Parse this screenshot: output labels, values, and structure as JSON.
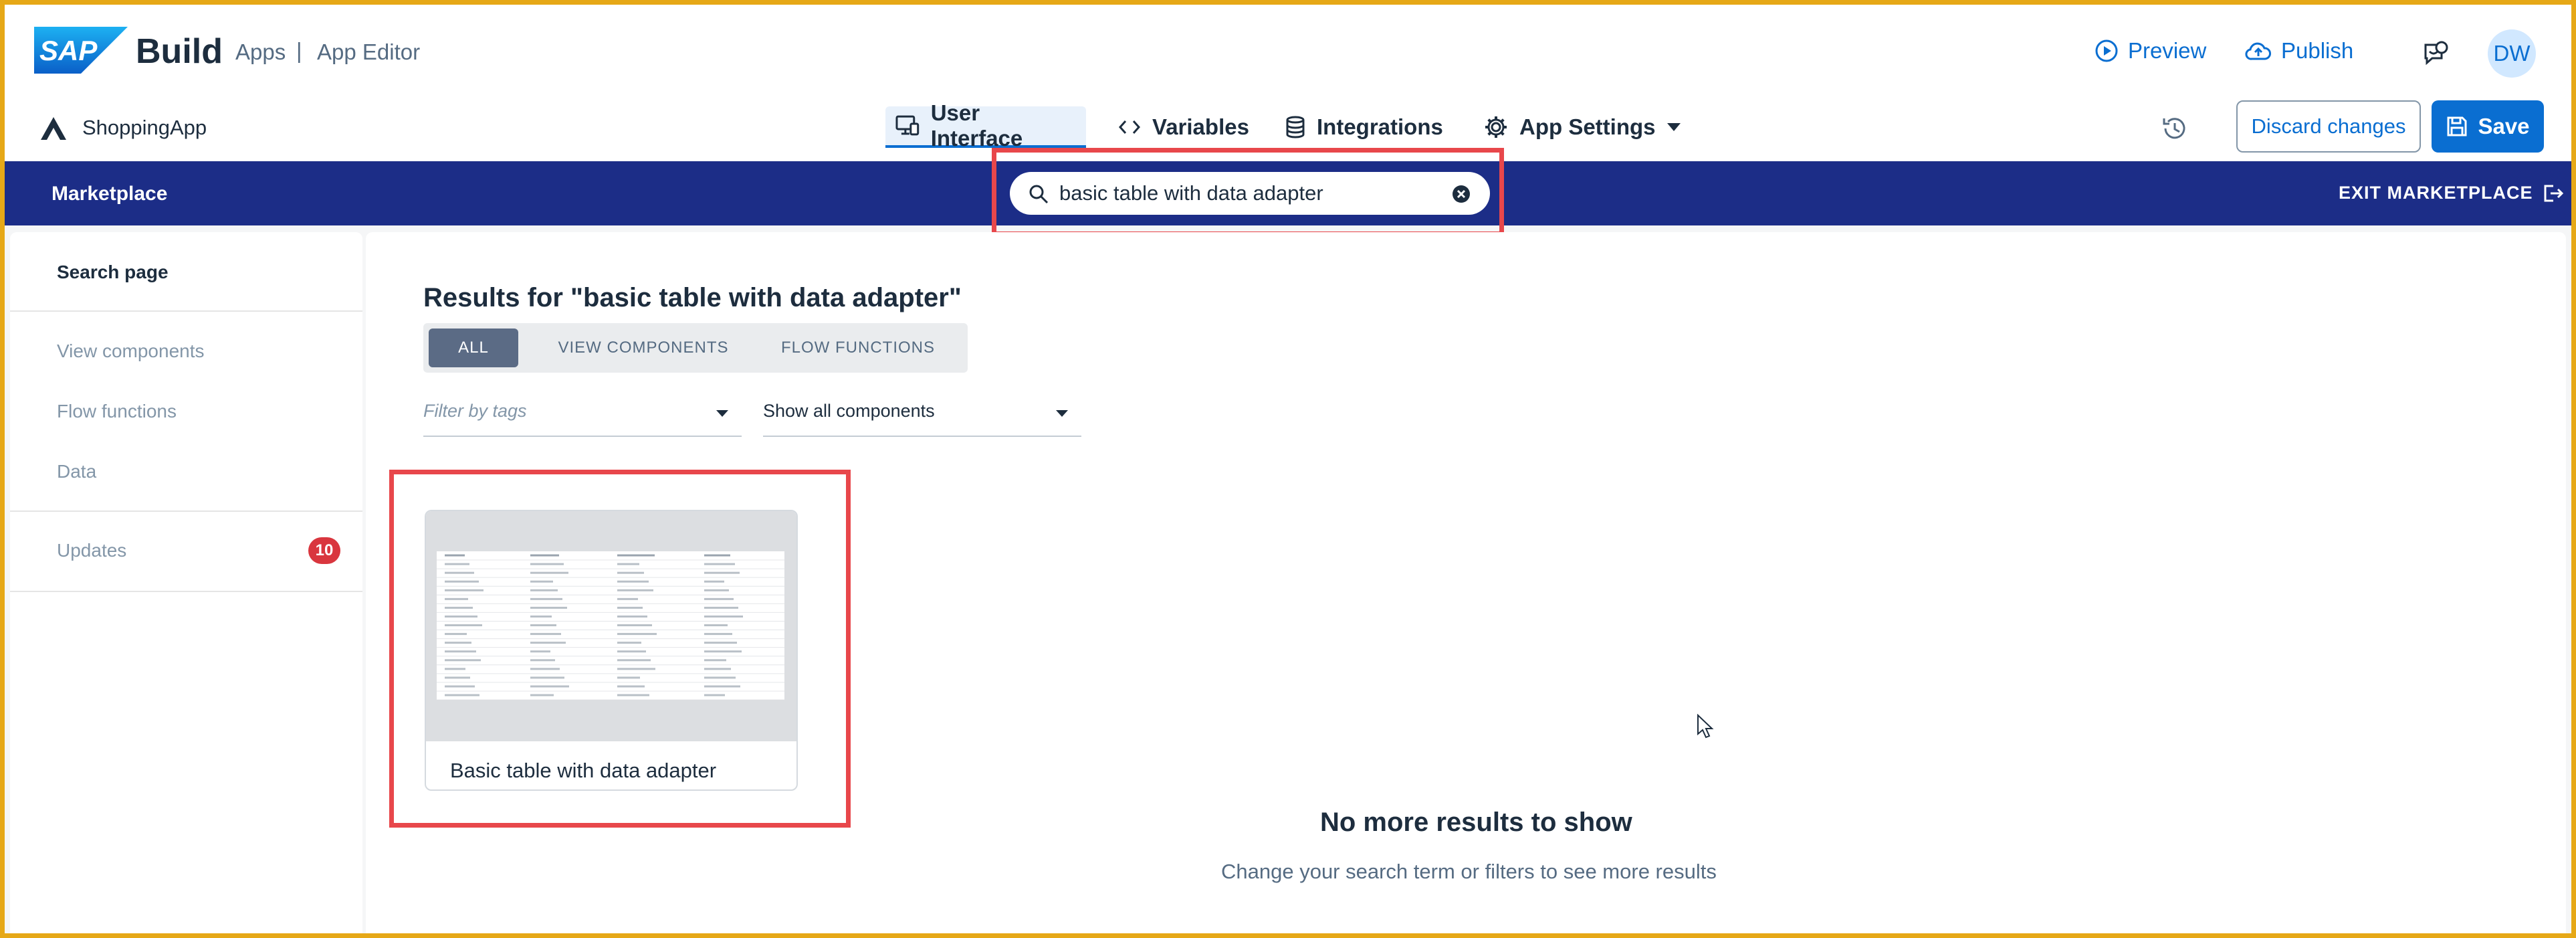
{
  "header": {
    "brand_logo": "SAP",
    "brand": "Build",
    "crumb_apps": "Apps",
    "crumb_sep": "|",
    "crumb_editor": "App Editor",
    "preview_label": "Preview",
    "publish_label": "Publish",
    "avatar_initials": "DW"
  },
  "toolbar": {
    "app_name": "ShoppingApp",
    "tabs": [
      {
        "label": "User Interface",
        "icon": "monitor-icon",
        "active": true
      },
      {
        "label": "Variables",
        "icon": "code-icon",
        "active": false
      },
      {
        "label": "Integrations",
        "icon": "database-icon",
        "active": false
      },
      {
        "label": "App Settings",
        "icon": "gear-icon",
        "active": false
      }
    ],
    "discard_label": "Discard changes",
    "save_label": "Save"
  },
  "marketplace": {
    "title": "Marketplace",
    "search_value": "basic table with data adapter",
    "exit_label": "EXIT MARKETPLACE"
  },
  "sidebar": {
    "items": [
      {
        "label": "Search page",
        "active": true
      },
      {
        "label": "View components",
        "active": false
      },
      {
        "label": "Flow functions",
        "active": false
      },
      {
        "label": "Data",
        "active": false
      },
      {
        "label": "Updates",
        "active": false
      }
    ],
    "updates_badge": "10"
  },
  "main": {
    "results_title": "Results for \"basic table with data adapter\"",
    "filter_tabs": [
      {
        "label": "ALL",
        "active": true
      },
      {
        "label": "VIEW COMPONENTS",
        "active": false
      },
      {
        "label": "FLOW FUNCTIONS",
        "active": false
      }
    ],
    "tag_filter_placeholder": "Filter by tags",
    "component_filter_value": "Show all components",
    "cards": [
      {
        "title": "Basic table with data adapter"
      }
    ],
    "empty_title": "No more results to show",
    "empty_subtitle": "Change your search term or filters to see more results"
  },
  "colors": {
    "accent": "#0a6ed1",
    "marketplace_bar": "#1c2d87",
    "highlight": "#e8474b",
    "badge": "#d9363e",
    "screen_border": "#e6a817"
  }
}
